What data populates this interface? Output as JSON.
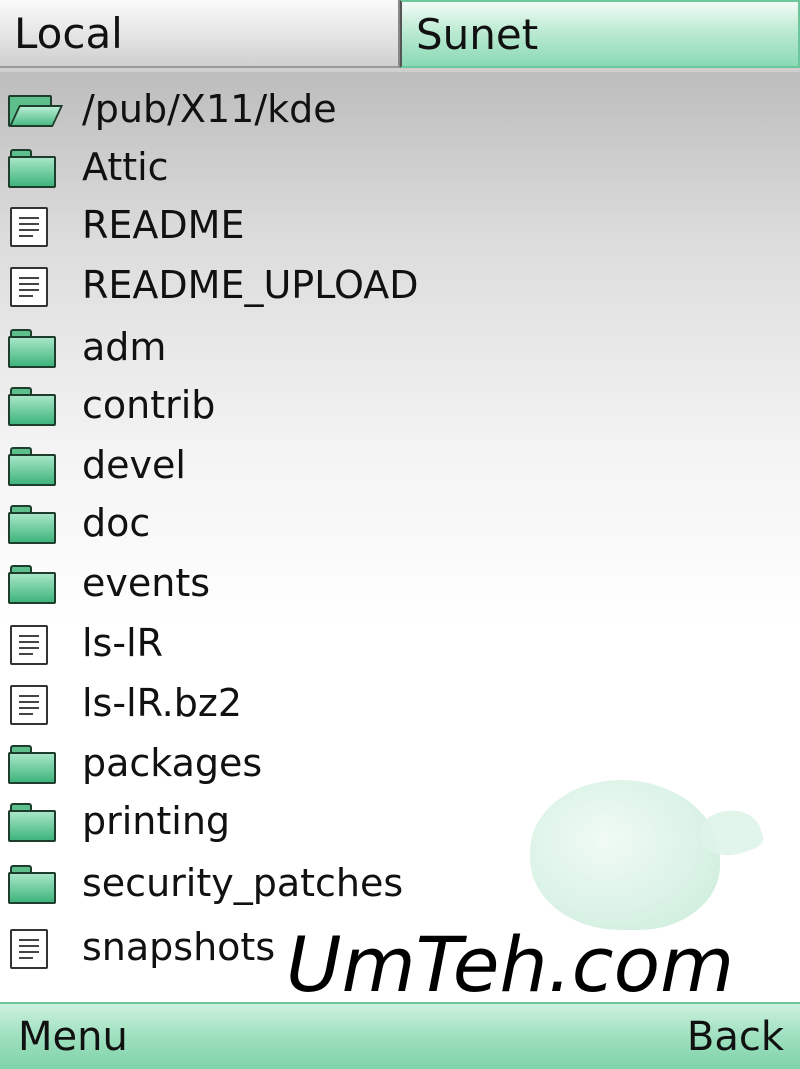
{
  "tabs": {
    "local_label": "Local",
    "remote_label": "Sunet"
  },
  "list": {
    "items": [
      {
        "label": "/pub/X11/kde",
        "icon": "open-folder-icon"
      },
      {
        "label": "Attic",
        "icon": "folder-icon"
      },
      {
        "label": "README",
        "icon": "document-icon"
      },
      {
        "label": "README_UPLOAD",
        "icon": "document-icon"
      },
      {
        "label": "adm",
        "icon": "folder-icon"
      },
      {
        "label": "contrib",
        "icon": "folder-icon"
      },
      {
        "label": "devel",
        "icon": "folder-icon"
      },
      {
        "label": "doc",
        "icon": "folder-icon"
      },
      {
        "label": "events",
        "icon": "folder-icon"
      },
      {
        "label": "ls-lR",
        "icon": "document-icon"
      },
      {
        "label": "ls-lR.bz2",
        "icon": "document-icon"
      },
      {
        "label": "packages",
        "icon": "folder-icon"
      },
      {
        "label": "printing",
        "icon": "folder-icon"
      },
      {
        "label": "security_patches",
        "icon": "folder-icon"
      },
      {
        "label": "snapshots",
        "icon": "document-icon"
      }
    ]
  },
  "watermark": "UmTeh.com",
  "softkeys": {
    "left_label": "Menu",
    "right_label": "Back"
  },
  "colors": {
    "accent_green": "#8ad9b5",
    "folder_green": "#3fb47c"
  }
}
